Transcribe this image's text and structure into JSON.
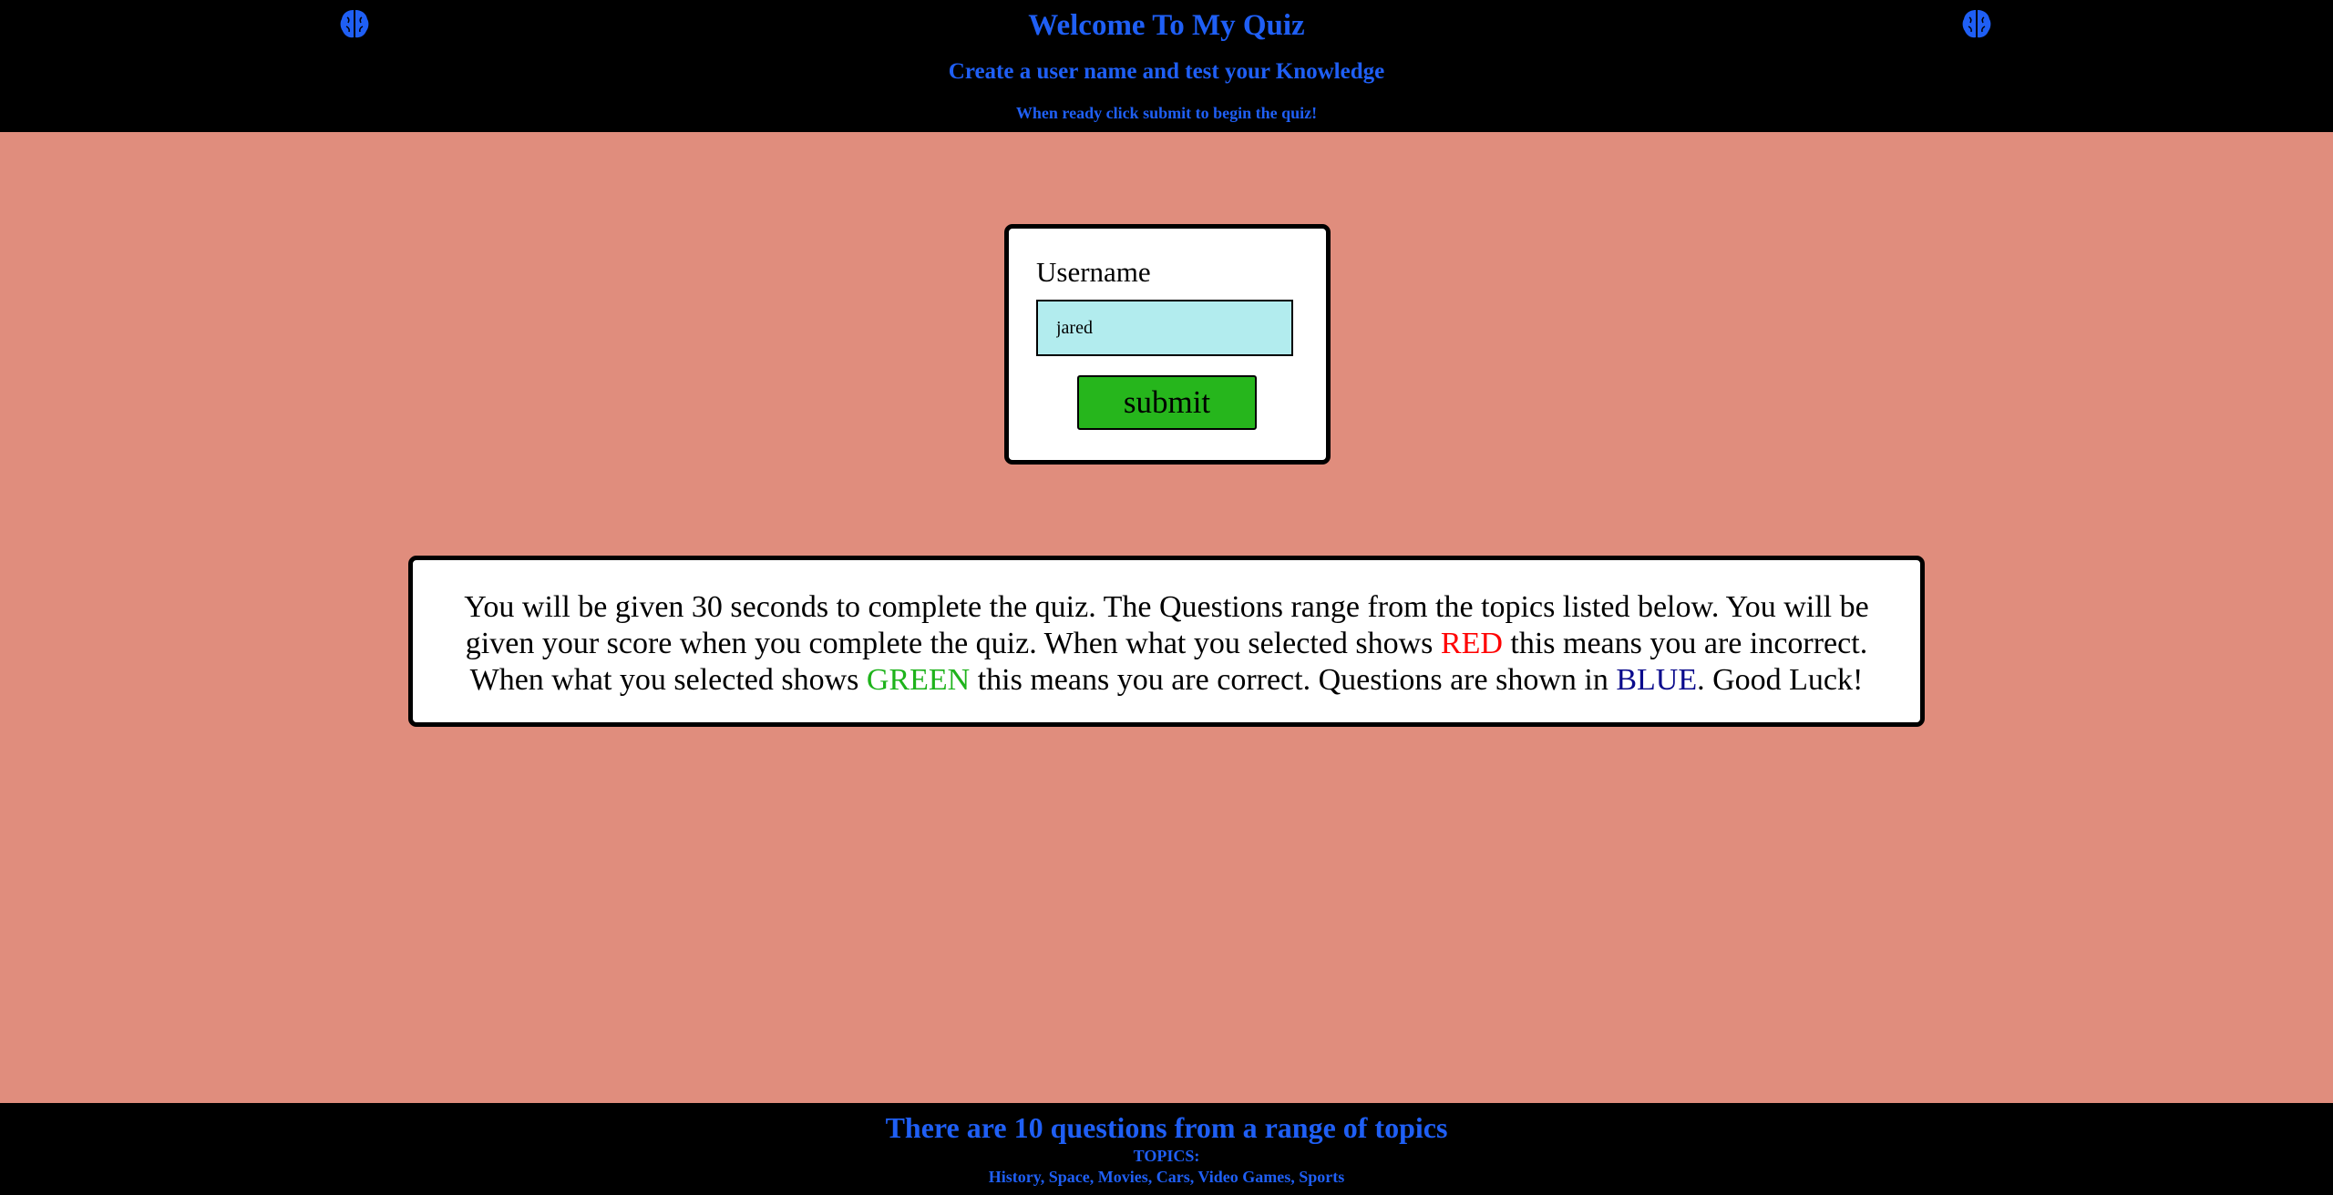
{
  "colors": {
    "accent_blue": "#1f5ff5",
    "header_bg": "#000000",
    "page_bg": "#e08d7d",
    "input_bg": "#b2ecee",
    "submit_bg": "#26b61c",
    "red": "#ff0000",
    "green": "#1eb31b",
    "blue": "#0a0a8c"
  },
  "header": {
    "title": "Welcome To My Quiz",
    "subtitle": "Create a user name and test your Knowledge",
    "instruction": "When ready click submit to begin the quiz!",
    "left_icon": "brain-icon",
    "right_icon": "brain-icon"
  },
  "login": {
    "label": "Username",
    "input_value": "jared",
    "submit_label": "submit"
  },
  "info": {
    "part1": "You will be given 30 seconds to complete the quiz. The Questions range from the topics listed below. You will be given your score when you complete the quiz. When what you selected shows ",
    "red_word": "RED",
    "part2": " this means you are incorrect. When what you selected shows ",
    "green_word": "GREEN",
    "part3": " this means you are correct. Questions are shown in ",
    "blue_word": "BLUE",
    "part4": ". Good Luck!"
  },
  "footer": {
    "title": "There are 10 questions from a range of topics",
    "topics_label": "TOPICS:",
    "topics": "History, Space, Movies, Cars, Video Games, Sports"
  }
}
